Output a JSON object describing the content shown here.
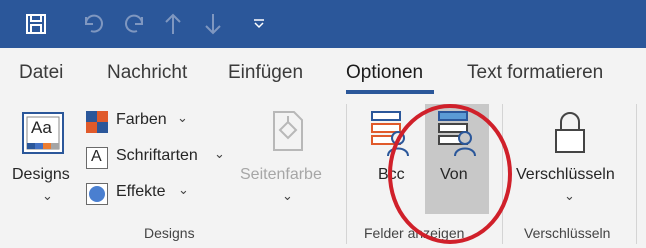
{
  "qat": {
    "save_icon": "save-icon",
    "undo_icon": "undo-icon",
    "redo_icon": "redo-icon",
    "up_icon": "arrow-up-icon",
    "down_icon": "arrow-down-icon",
    "customize_icon": "customize-qat-icon"
  },
  "tabs": {
    "datei": "Datei",
    "nachricht": "Nachricht",
    "einfuegen": "Einfügen",
    "optionen": "Optionen",
    "text_formatieren": "Text formatieren"
  },
  "ribbon": {
    "designs_label": "Designs",
    "farben_label": "Farben",
    "schriftarten_label": "Schriftarten",
    "effekte_label": "Effekte",
    "seitenfarbe_label": "Seitenfarbe",
    "bcc_label": "Bcc",
    "von_label": "Von",
    "verschluesseln_label": "Verschlüsseln",
    "designs_group": "Designs",
    "felder_group": "Felder anzeigen",
    "verschluesseln_group": "Verschlüsseln",
    "theme_font_glyph": "Aa",
    "font_glyph": "A",
    "dropdown_glyph": "⌄"
  },
  "colors": {
    "qat_bg": "#2b579a",
    "accent": "#2b579a",
    "highlight": "#c8c8c8",
    "annotation_circle": "#d0202a"
  }
}
